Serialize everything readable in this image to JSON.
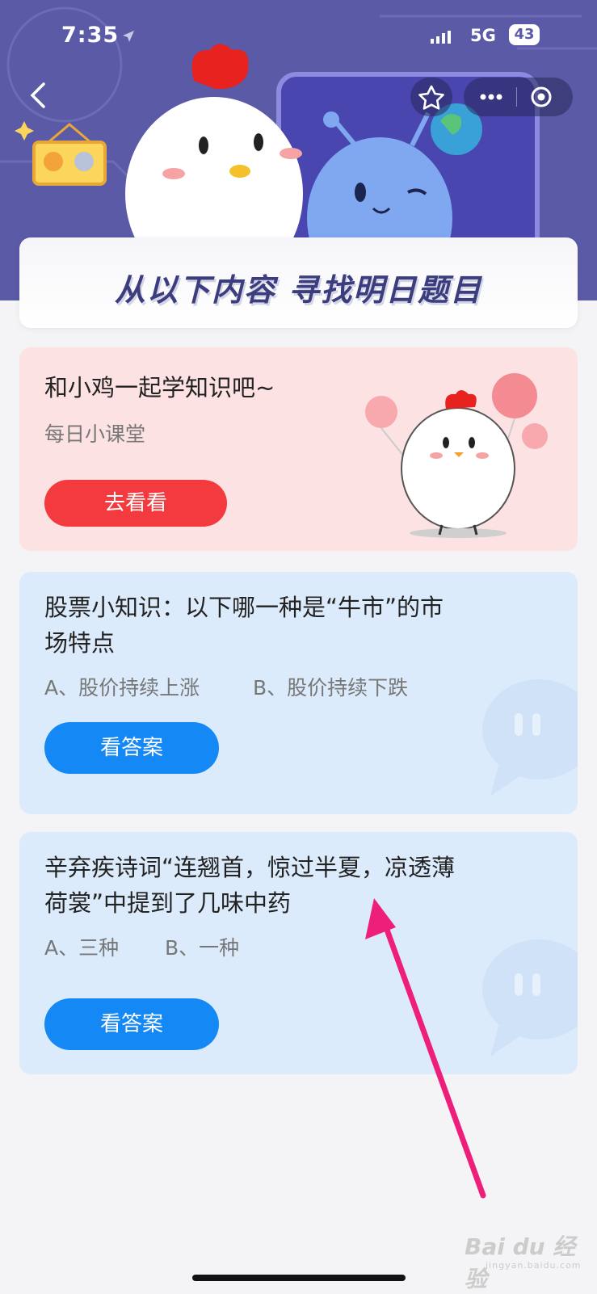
{
  "status_bar": {
    "time": "7:35",
    "network": "5G",
    "battery": "43"
  },
  "header": {
    "banner_title": "从以下内容 寻找明日题目"
  },
  "cards": [
    {
      "title": "和小鸡一起学知识吧~",
      "subtitle": "每日小课堂",
      "button": "去看看"
    },
    {
      "title_line1": "股票小知识：以下哪一种是“牛市”的市",
      "title_line2": "场特点",
      "option_a": "A、股价持续上涨",
      "option_b": "B、股价持续下跌",
      "button": "看答案"
    },
    {
      "title_line1": "辛弃疾诗词“连翘首，惊过半夏，凉透薄",
      "title_line2": "荷裳”中提到了几味中药",
      "option_a": "A、三种",
      "option_b": "B、一种",
      "button": "看答案"
    }
  ],
  "watermark": {
    "brand": "Bai du 经验",
    "url": "jingyan.baidu.com"
  },
  "colors": {
    "header_bg": "#5b5aa7",
    "pink_card": "#fde2e3",
    "blue_card": "#dcebfb",
    "red_button": "#f23a3f",
    "blue_button": "#1488f5",
    "annotation_arrow": "#ee1f7a"
  }
}
